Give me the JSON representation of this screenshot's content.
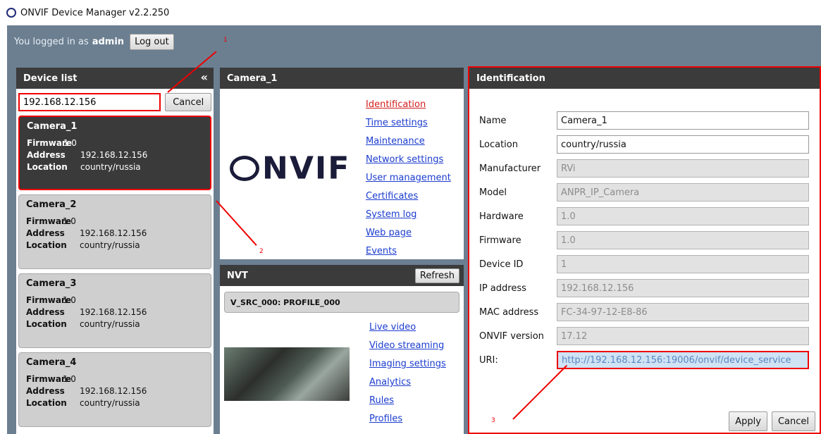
{
  "window": {
    "title": "ONVIF Device Manager v2.2.250"
  },
  "userbar": {
    "prefix": "You logged in as",
    "user": "admin",
    "logout_label": "Log out"
  },
  "device_list": {
    "title": "Device list",
    "collapse_glyph": "«",
    "search_value": "192.168.12.156",
    "cancel_label": "Cancel",
    "labels": {
      "firmware": "Firmware",
      "address": "Address",
      "location": "Location"
    },
    "devices": [
      {
        "name": "Camera_1",
        "firmware": "1.0",
        "address": "192.168.12.156",
        "location": "country/russia"
      },
      {
        "name": "Camera_2",
        "firmware": "1.0",
        "address": "192.168.12.156",
        "location": "country/russia"
      },
      {
        "name": "Camera_3",
        "firmware": "1.0",
        "address": "192.168.12.156",
        "location": "country/russia"
      },
      {
        "name": "Camera_4",
        "firmware": "1.0",
        "address": "192.168.12.156",
        "location": "country/russia"
      }
    ]
  },
  "camera": {
    "title": "Camera_1",
    "logo_text": "NVIF",
    "menu": [
      "Identification",
      "Time settings",
      "Maintenance",
      "Network settings",
      "User management",
      "Certificates",
      "System log",
      "Web page",
      "Events"
    ]
  },
  "nvt": {
    "title": "NVT",
    "refresh_label": "Refresh",
    "profile": "V_SRC_000: PROFILE_000",
    "menu": [
      "Live video",
      "Video streaming",
      "Imaging settings",
      "Analytics",
      "Rules",
      "Profiles"
    ]
  },
  "identification": {
    "title": "Identification",
    "fields": [
      {
        "label": "Name",
        "value": "Camera_1"
      },
      {
        "label": "Location",
        "value": "country/russia"
      },
      {
        "label": "Manufacturer",
        "value": "RVi"
      },
      {
        "label": "Model",
        "value": "ANPR_IP_Camera"
      },
      {
        "label": "Hardware",
        "value": "1.0"
      },
      {
        "label": "Firmware",
        "value": "1.0"
      },
      {
        "label": "Device ID",
        "value": "1"
      },
      {
        "label": "IP address",
        "value": "192.168.12.156"
      },
      {
        "label": "MAC address",
        "value": "FC-34-97-12-E8-86"
      },
      {
        "label": "ONVIF version",
        "value": "17.12"
      },
      {
        "label": "URI:",
        "value": "http://192.168.12.156:19006/onvif/device_service"
      }
    ],
    "apply_label": "Apply",
    "cancel_label": "Cancel"
  },
  "annotations": [
    "1",
    "2",
    "3"
  ],
  "colors": {
    "highlight": "#ee0000",
    "link": "#1b3cce",
    "active_link": "#d31d1d",
    "header": "#3b3b3b",
    "background": "#6b7f91"
  }
}
